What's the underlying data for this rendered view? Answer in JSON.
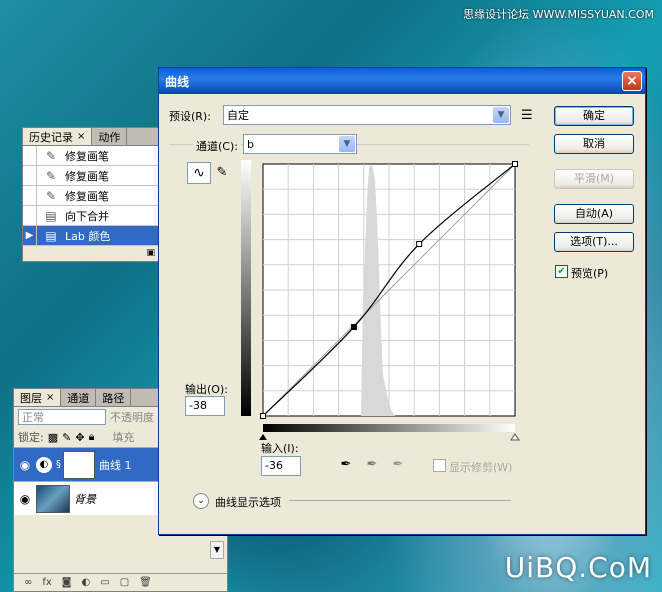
{
  "watermarks": {
    "top": "思缘设计论坛  WWW.MISSYUAN.COM",
    "bottom": "UiBQ.CoM"
  },
  "history_panel": {
    "tabs": [
      {
        "label": "历史记录",
        "close": "×"
      },
      {
        "label": "动作"
      }
    ],
    "items": [
      {
        "label": "修复画笔",
        "icon": "healing-brush-icon"
      },
      {
        "label": "修复画笔",
        "icon": "healing-brush-icon"
      },
      {
        "label": "修复画笔",
        "icon": "healing-brush-icon"
      },
      {
        "label": "向下合并",
        "icon": "merge-icon"
      },
      {
        "label": "Lab 颜色",
        "icon": "mode-icon",
        "selected": true
      }
    ]
  },
  "layers_panel": {
    "tabs": [
      {
        "label": "图层",
        "close": "×"
      },
      {
        "label": "通道"
      },
      {
        "label": "路径"
      }
    ],
    "blend_mode": "正常",
    "opacity_label": "不透明度",
    "lock_label": "锁定:",
    "fill_label": "填充",
    "layers": [
      {
        "name": "曲线 1",
        "selected": true
      },
      {
        "name": "背景"
      }
    ]
  },
  "curves_dialog": {
    "title": "曲线",
    "close": "×",
    "preset_label": "预设(R):",
    "preset_value": "自定",
    "channel_label": "通道(C):",
    "channel_value": "b",
    "output_label": "输出(O):",
    "output_value": "-38",
    "input_label": "输入(I):",
    "input_value": "-36",
    "show_clipping_label": "显示修剪(W)",
    "curve_display_options": "曲线显示选项",
    "buttons": {
      "ok": "确定",
      "cancel": "取消",
      "smooth": "平滑(M)",
      "auto": "自动(A)",
      "options": "选项(T)...",
      "preview": "预览(P)"
    },
    "curve_points": [
      [
        -128,
        -128
      ],
      [
        -36,
        -38
      ],
      [
        30,
        46
      ],
      [
        127,
        127
      ]
    ]
  }
}
